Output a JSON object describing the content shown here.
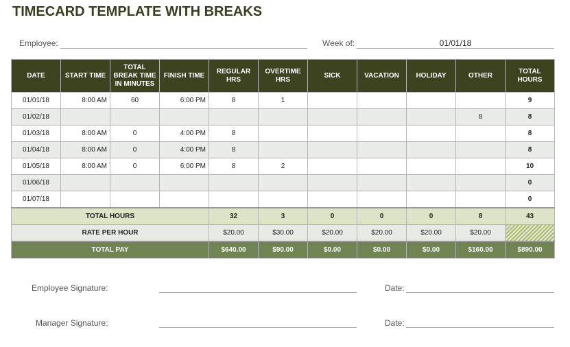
{
  "title": "TIMECARD TEMPLATE WITH BREAKS",
  "employee_label": "Employee:",
  "employee_value": "",
  "week_label": "Week of:",
  "week_value": "01/01/18",
  "headers": [
    "DATE",
    "START TIME",
    "TOTAL BREAK TIME IN MINUTES",
    "FINISH TIME",
    "REGULAR HRS",
    "OVERTIME HRS",
    "SICK",
    "VACATION",
    "HOLIDAY",
    "OTHER",
    "TOTAL HOURS"
  ],
  "rows": [
    [
      "01/01/18",
      "8:00 AM",
      "60",
      "6:00 PM",
      "8",
      "1",
      "",
      "",
      "",
      "",
      "9"
    ],
    [
      "01/02/18",
      "",
      "",
      "",
      "",
      "",
      "",
      "",
      "",
      "8",
      "8"
    ],
    [
      "01/03/18",
      "8:00 AM",
      "0",
      "4:00 PM",
      "8",
      "",
      "",
      "",
      "",
      "",
      "8"
    ],
    [
      "01/04/18",
      "8:00 AM",
      "0",
      "4:00 PM",
      "8",
      "",
      "",
      "",
      "",
      "",
      "8"
    ],
    [
      "01/05/18",
      "8:00 AM",
      "0",
      "6:00 PM",
      "8",
      "2",
      "",
      "",
      "",
      "",
      "10"
    ],
    [
      "01/06/18",
      "",
      "",
      "",
      "",
      "",
      "",
      "",
      "",
      "",
      "0"
    ],
    [
      "01/07/18",
      "",
      "",
      "",
      "",
      "",
      "",
      "",
      "",
      "",
      "0"
    ]
  ],
  "total_hours": {
    "label": "TOTAL HOURS",
    "values": [
      "32",
      "3",
      "0",
      "0",
      "0",
      "8",
      "43"
    ]
  },
  "rate": {
    "label": "RATE PER HOUR",
    "values": [
      "$20.00",
      "$30.00",
      "$20.00",
      "$20.00",
      "$20.00",
      "$20.00"
    ]
  },
  "total_pay": {
    "label": "TOTAL PAY",
    "values": [
      "$640.00",
      "$90.00",
      "$0.00",
      "$0.00",
      "$0.00",
      "$160.00",
      "$890.00"
    ]
  },
  "signatures": {
    "employee": "Employee Signature:",
    "manager": "Manager Signature:",
    "date": "Date:"
  },
  "colors": {
    "header": "#3d421f",
    "total_hours": "#dde3c6",
    "total_pay": "#6f8353"
  }
}
